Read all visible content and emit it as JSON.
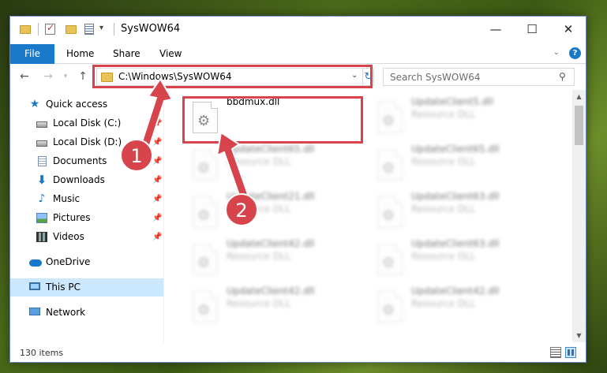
{
  "window": {
    "title": "SysWOW64",
    "controls": {
      "minimize": "—",
      "maximize": "☐",
      "close": "✕"
    }
  },
  "ribbon": {
    "tabs": [
      "File",
      "Home",
      "Share",
      "View"
    ],
    "help": "?"
  },
  "address": {
    "path": "C:\\Windows\\SysWOW64",
    "search_placeholder": "Search SysWOW64"
  },
  "sidebar": {
    "items": [
      {
        "label": "Quick access",
        "icon": "star-icon"
      },
      {
        "label": "Local Disk (C:)",
        "icon": "drive-icon",
        "pinned": true
      },
      {
        "label": "Local Disk (D:)",
        "icon": "drive-icon",
        "pinned": true
      },
      {
        "label": "Documents",
        "icon": "documents-icon",
        "pinned": true
      },
      {
        "label": "Downloads",
        "icon": "download-icon",
        "pinned": true
      },
      {
        "label": "Music",
        "icon": "music-icon",
        "pinned": true
      },
      {
        "label": "Pictures",
        "icon": "pictures-icon",
        "pinned": true
      },
      {
        "label": "Videos",
        "icon": "videos-icon",
        "pinned": true
      },
      {
        "label": "OneDrive",
        "icon": "onedrive-icon"
      },
      {
        "label": "This PC",
        "icon": "this-pc-icon",
        "selected": true
      },
      {
        "label": "Network",
        "icon": "network-icon"
      }
    ]
  },
  "files": [
    {
      "name": "bbdmux.dll",
      "type": "",
      "highlighted": true
    },
    {
      "name": "UpdateClient5.dll",
      "type": "Resource DLL"
    },
    {
      "name": "UpdateClient65.dll",
      "type": "Resource DLL"
    },
    {
      "name": "UpdateClient65.dll",
      "type": "Resource DLL"
    },
    {
      "name": "UpdateClient21.dll",
      "type": "Resource DLL"
    },
    {
      "name": "UpdateClient63.dll",
      "type": "Resource DLL"
    },
    {
      "name": "UpdateClient42.dll",
      "type": "Resource DLL"
    },
    {
      "name": "UpdateClient63.dll",
      "type": "Resource DLL"
    },
    {
      "name": "UpdateClient42.dll",
      "type": "Resource DLL"
    },
    {
      "name": "UpdateClient42.dll",
      "type": "Resource DLL"
    }
  ],
  "status": {
    "item_count": "130 items"
  },
  "annotations": {
    "step1": "1",
    "step2": "2",
    "color": "#d8444c"
  }
}
